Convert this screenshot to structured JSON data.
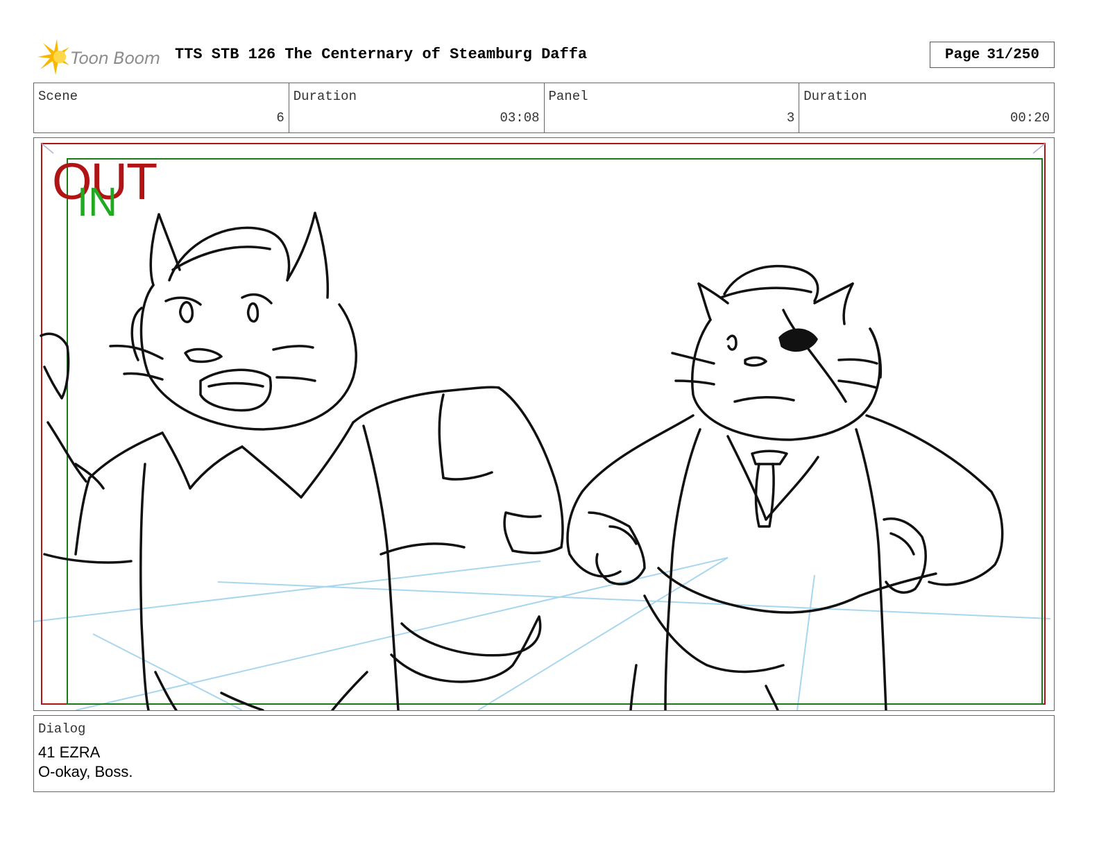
{
  "header": {
    "logo_text": "Toon Boom",
    "title": "TTS STB 126 The Centernary of Steamburg Daffa",
    "page_label": "Page",
    "page_value": "31/250"
  },
  "info": {
    "scene_label": "Scene",
    "scene_value": "6",
    "scene_duration_label": "Duration",
    "scene_duration_value": "03:08",
    "panel_label": "Panel",
    "panel_value": "3",
    "panel_duration_label": "Duration",
    "panel_duration_value": "00:20"
  },
  "panel": {
    "out_label": "OUT",
    "in_label": "IN",
    "colors": {
      "out_frame": "#b01414",
      "in_frame": "#1a7a1a",
      "guide_lines": "#a9d6ef"
    }
  },
  "dialog": {
    "label": "Dialog",
    "lines": [
      "41 EZRA",
      "O-okay, Boss."
    ]
  },
  "colors": {
    "logo_star": "#f6b800",
    "logo_text": "#8c8c8c"
  }
}
